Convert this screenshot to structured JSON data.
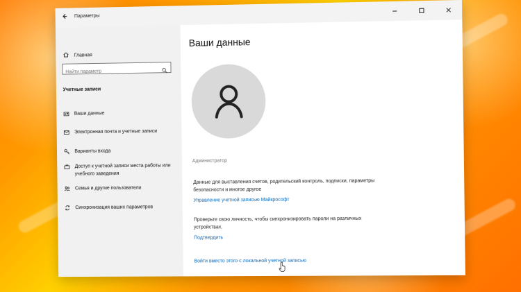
{
  "window": {
    "title": "Параметры"
  },
  "sidebar": {
    "home": "Главная",
    "search_placeholder": "Найти параметр",
    "section_title": "Учетные записи",
    "items": [
      {
        "label": "Ваши данные",
        "icon": "user-card-icon"
      },
      {
        "label": "Электронная почта и учетные записи",
        "icon": "mail-icon"
      },
      {
        "label": "Варианты входа",
        "icon": "key-icon"
      },
      {
        "label": "Доступ к учетной записи места работы или учебного заведения",
        "icon": "briefcase-icon"
      },
      {
        "label": "Семья и другие пользователи",
        "icon": "people-icon"
      },
      {
        "label": "Синхронизация ваших параметров",
        "icon": "sync-icon"
      }
    ]
  },
  "content": {
    "title": "Ваши данные",
    "account_role": "Администратор",
    "description_1": "Данные для выставления счетов, родительский контроль, подписки, параметры безопасности и многое другое",
    "manage_link": "Управление учетной записью Майкрософт",
    "description_2": "Проверьте свою личность, чтобы синхронизировать пароли на различных устройствах.",
    "verify_link": "Подтвердить",
    "local_account_link": "Войти вместо этого с локальной учетной записью"
  },
  "colors": {
    "link": "#0b69b8",
    "sidebar_bg": "#f1f1f1",
    "avatar_bg": "#d9d9d9"
  }
}
